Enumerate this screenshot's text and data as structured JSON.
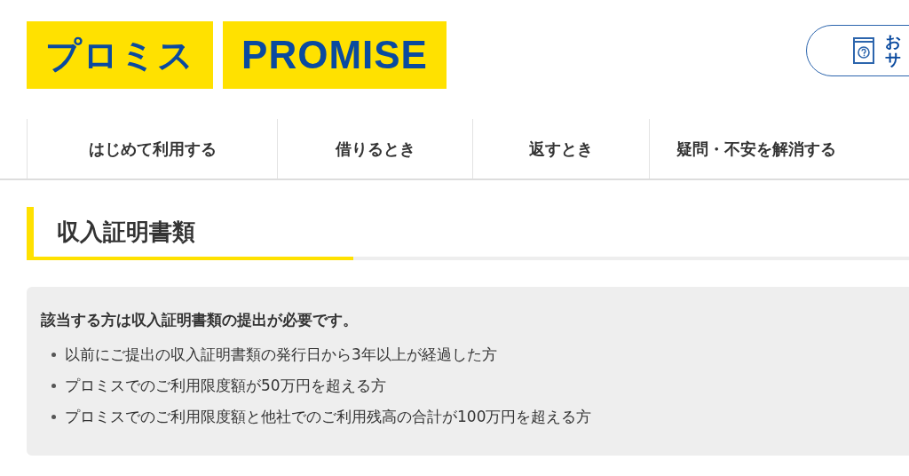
{
  "logo": {
    "katakana": "プロミス",
    "latin": "PROMISE"
  },
  "help_button": {
    "lines": [
      "お",
      "サ"
    ]
  },
  "nav": [
    {
      "label": "はじめて利用する"
    },
    {
      "label": "借りるとき"
    },
    {
      "label": "返すとき"
    },
    {
      "label": "疑問・不安を解消する"
    }
  ],
  "heading": "収入証明書類",
  "notice": {
    "title": "該当する方は収入証明書類の提出が必要です。",
    "items": [
      "以前にご提出の収入証明書類の発行日から3年以上が経過した方",
      "プロミスでのご利用限度額が50万円を超える方",
      "プロミスでのご利用限度額と他社でのご利用残高の合計が100万円を超える方"
    ]
  }
}
